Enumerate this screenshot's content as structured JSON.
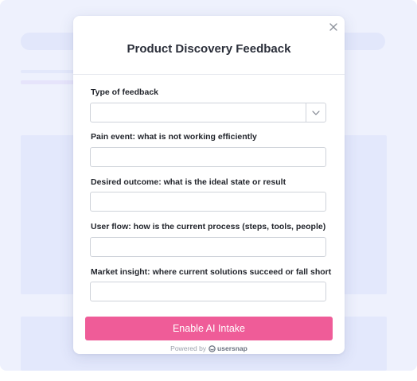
{
  "modal": {
    "title": "Product Discovery Feedback",
    "close_icon": "close-icon"
  },
  "fields": {
    "type": {
      "label": "Type of feedback",
      "value": "",
      "icon": "chevron-down-icon"
    },
    "pain": {
      "label": "Pain event: what is not working efficiently",
      "value": "",
      "placeholder": ""
    },
    "outcome": {
      "label": "Desired outcome: what is the ideal state or result",
      "value": "",
      "placeholder": ""
    },
    "flow": {
      "label": "User flow: how is the current process (steps, tools, people)",
      "value": "",
      "placeholder": ""
    },
    "market": {
      "label": "Market insight: where current solutions succeed or fall short",
      "value": "",
      "placeholder": ""
    }
  },
  "submit": {
    "label": "Enable AI Intake"
  },
  "footer": {
    "powered_by": "Powered by",
    "brand": "usersnap",
    "brand_icon": "usersnap-logo-icon"
  },
  "colors": {
    "accent": "#ef5c98",
    "background_app": "#eef1fd"
  }
}
